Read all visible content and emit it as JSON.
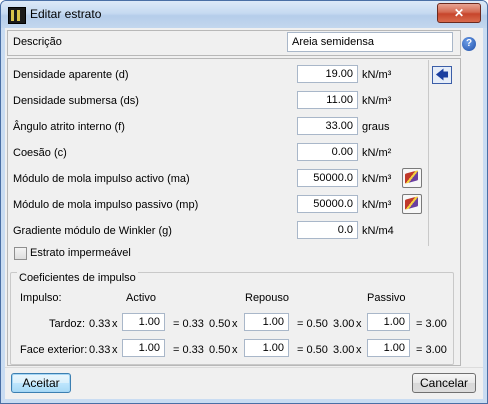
{
  "window": {
    "title": "Editar estrato",
    "close_label": "✕"
  },
  "descricao": {
    "label": "Descrição",
    "value": "Areia semidensa"
  },
  "fields": [
    {
      "label": "Densidade aparente (d)",
      "value": "19.00",
      "unit": "kN/m³"
    },
    {
      "label": "Densidade submersa (ds)",
      "value": "11.00",
      "unit": "kN/m³"
    },
    {
      "label": "Ângulo atrito interno (f)",
      "value": "33.00",
      "unit": "graus"
    },
    {
      "label": "Coesão (c)",
      "value": "0.00",
      "unit": "kN/m²"
    },
    {
      "label": "Módulo de mola impulso activo (ma)",
      "value": "50000.0",
      "unit": "kN/m³"
    },
    {
      "label": "Módulo de mola impulso passivo (mp)",
      "value": "50000.0",
      "unit": "kN/m³"
    },
    {
      "label": "Gradiente módulo de Winkler (g)",
      "value": "0.0",
      "unit": "kN/m4"
    }
  ],
  "checkbox": {
    "label": "Estrato impermeável",
    "checked": false
  },
  "coef": {
    "title": "Coeficientes de impulso",
    "impulso_label": "Impulso:",
    "headers": {
      "activo": "Activo",
      "repouso": "Repouso",
      "passivo": "Passivo"
    },
    "rows": [
      {
        "label": "Tardoz:",
        "activo": {
          "base": "0.33",
          "x": "x",
          "factor": "1.00",
          "result": "= 0.33"
        },
        "repouso": {
          "base": "0.50",
          "x": "x",
          "factor": "1.00",
          "result": "= 0.50"
        },
        "passivo": {
          "base": "3.00",
          "x": "x",
          "factor": "1.00",
          "result": "= 3.00"
        }
      },
      {
        "label": "Face exterior:",
        "activo": {
          "base": "0.33",
          "x": "x",
          "factor": "1.00",
          "result": "= 0.33"
        },
        "repouso": {
          "base": "0.50",
          "x": "x",
          "factor": "1.00",
          "result": "= 0.50"
        },
        "passivo": {
          "base": "3.00",
          "x": "x",
          "factor": "1.00",
          "result": "= 3.00"
        }
      }
    ]
  },
  "buttons": {
    "ok": "Aceitar",
    "cancel": "Cancelar"
  },
  "icons": {
    "help": "?",
    "arrow": "🡄"
  }
}
